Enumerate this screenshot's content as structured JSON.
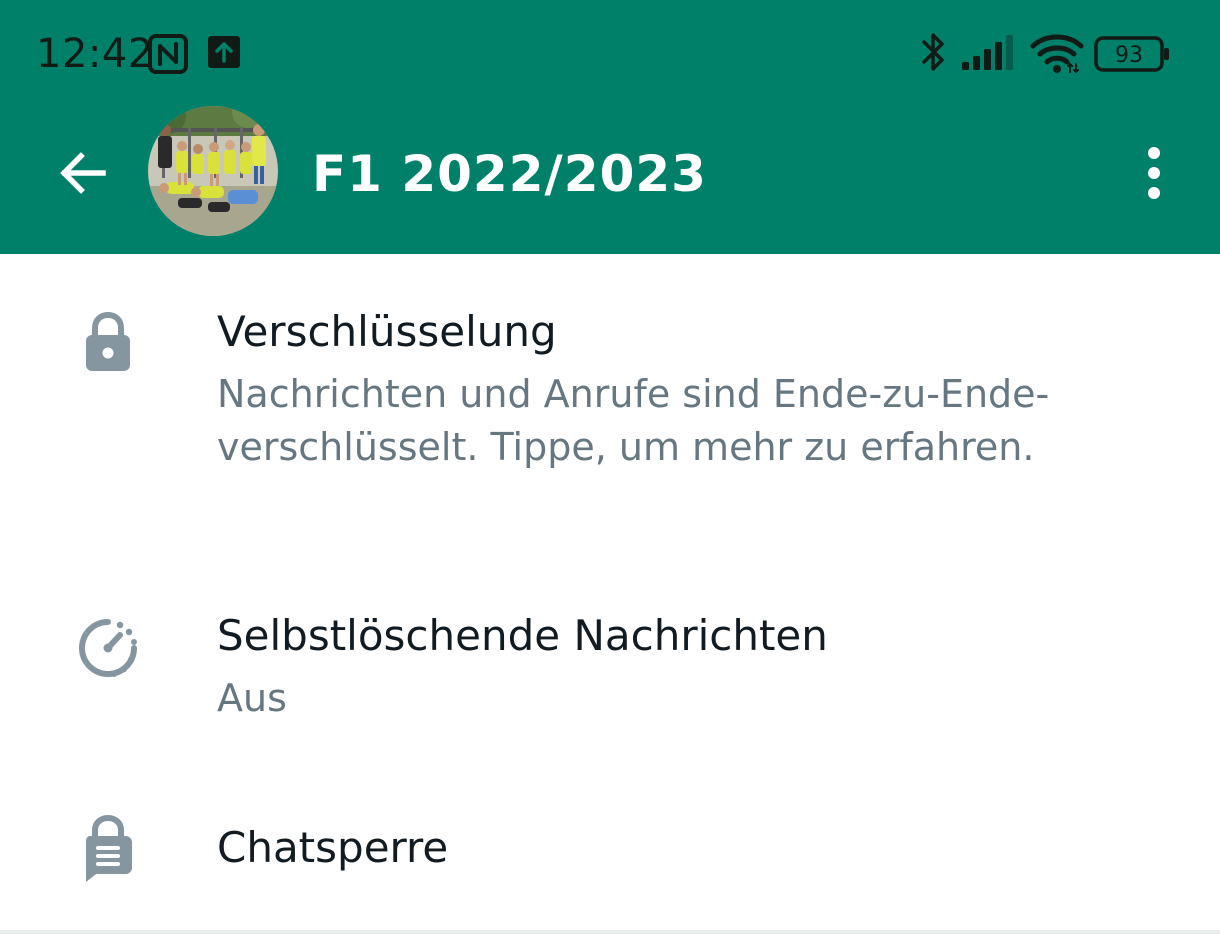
{
  "status_bar": {
    "time": "12:42",
    "battery_level": "93",
    "icons": [
      "nfc-icon",
      "upload-notification-icon",
      "bluetooth-icon",
      "signal-icon",
      "wifi-icon",
      "battery-icon"
    ]
  },
  "header": {
    "back_icon": "arrow-left-icon",
    "title": "F1 2022/2023",
    "more_icon": "more-vertical-icon"
  },
  "settings": {
    "encryption": {
      "icon": "lock-icon",
      "title": "Verschlüsselung",
      "subtitle": "Nachrichten und Anrufe sind Ende-zu-Ende-verschlüsselt. Tippe, um mehr zu erfahren."
    },
    "disappearing": {
      "icon": "timer-icon",
      "title": "Selbstlöschende Nachrichten",
      "subtitle": "Aus"
    },
    "chatlock": {
      "icon": "chat-lock-icon",
      "title": "Chatsperre"
    }
  },
  "colors": {
    "header_bg": "#008069",
    "status_text": "#111b16",
    "title_text": "#111b21",
    "subtitle_text": "#667781",
    "icon_gray": "#8696a0"
  }
}
